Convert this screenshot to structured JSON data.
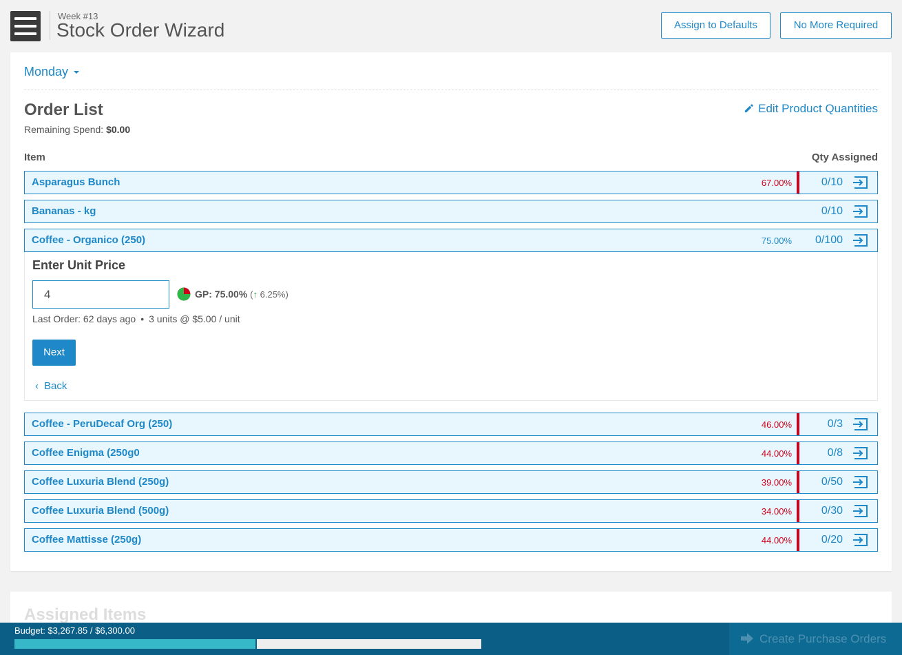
{
  "header": {
    "week": "Week #13",
    "title": "Stock Order Wizard",
    "assign_defaults_label": "Assign to Defaults",
    "no_more_required_label": "No More Required"
  },
  "day_selector": {
    "value": "Monday"
  },
  "order_list": {
    "title": "Order List",
    "edit_label": "Edit Product Quantities",
    "remaining_label": "Remaining Spend:",
    "remaining_value": "$0.00",
    "col_item": "Item",
    "col_qty": "Qty Assigned",
    "items": [
      {
        "name": "Asparagus Bunch",
        "gp": "67.00%",
        "gp_color": "#d0021b",
        "qty": "0/10",
        "flag": true
      },
      {
        "name": "Bananas - kg",
        "gp": "",
        "gp_color": "",
        "qty": "0/10",
        "flag": false
      },
      {
        "name": "Coffee - Organico (250)",
        "gp": "75.00%",
        "gp_color": "#1e88c8",
        "qty": "0/100",
        "flag": false
      },
      {
        "name": "Coffee - PeruDecaf Org (250)",
        "gp": "46.00%",
        "gp_color": "#d0021b",
        "qty": "0/3",
        "flag": true
      },
      {
        "name": "Coffee Enigma (250g0",
        "gp": "44.00%",
        "gp_color": "#d0021b",
        "qty": "0/8",
        "flag": true
      },
      {
        "name": "Coffee Luxuria Blend (250g)",
        "gp": "39.00%",
        "gp_color": "#d0021b",
        "qty": "0/50",
        "flag": true
      },
      {
        "name": "Coffee Luxuria Blend (500g)",
        "gp": "34.00%",
        "gp_color": "#d0021b",
        "qty": "0/30",
        "flag": true
      },
      {
        "name": "Coffee Mattisse (250g)",
        "gp": "44.00%",
        "gp_color": "#d0021b",
        "qty": "0/20",
        "flag": true
      }
    ]
  },
  "unit_price_panel": {
    "label": "Enter Unit Price",
    "input_value": "4",
    "gp_label": "GP: 75.00%",
    "gp_change": "6.25%",
    "gp_fraction": 0.75,
    "last_order": "Last Order: 62 days ago",
    "last_units": "3 units @ $5.00 / unit",
    "next_label": "Next",
    "back_label": "Back"
  },
  "assigned": {
    "title": "Assigned Items"
  },
  "footer": {
    "budget_text": "Budget: $3,267.85 / $6,300.00",
    "budget_fraction": 0.5187,
    "create_label": "Create Purchase Orders"
  },
  "colors": {
    "accent": "#1e88c8",
    "warning": "#d0021b",
    "footer": "#0b5f86",
    "progress": "#37b8c8"
  }
}
